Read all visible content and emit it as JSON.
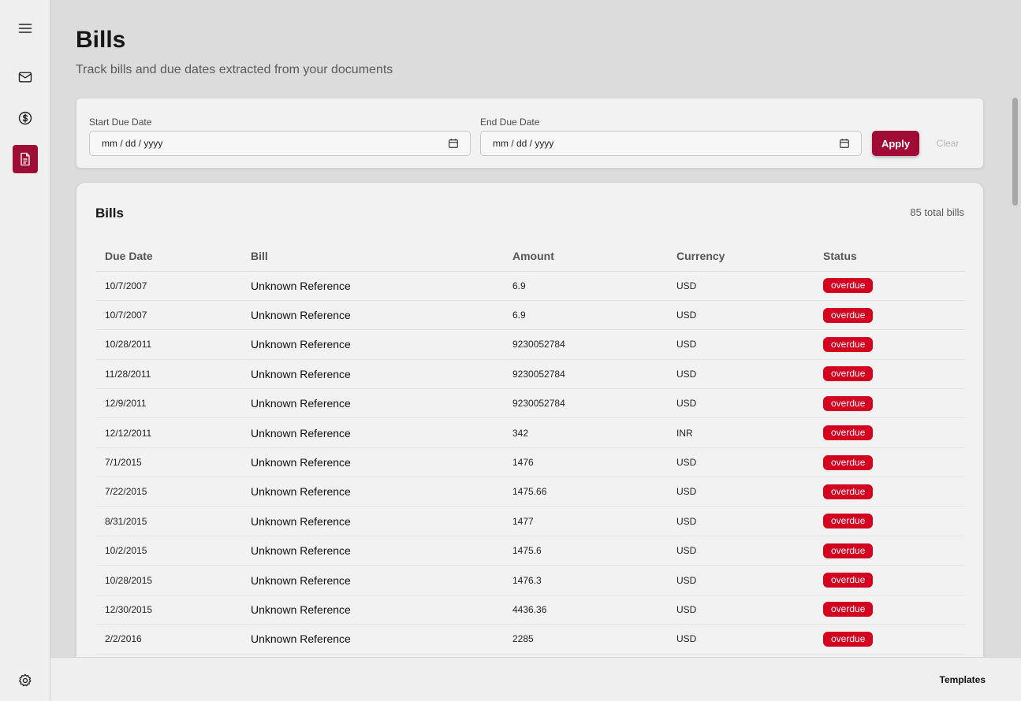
{
  "sidebar": {
    "items": [
      {
        "icon": "menu-icon",
        "active": false
      },
      {
        "icon": "mail-icon",
        "active": false
      },
      {
        "icon": "dollar-icon",
        "active": false
      },
      {
        "icon": "document-icon",
        "active": true
      },
      {
        "icon": "gear-icon",
        "active": false
      }
    ],
    "accent_color": "#9e0b33"
  },
  "header": {
    "title": "Bills",
    "subtitle": "Track bills and due dates extracted from your documents"
  },
  "filters": {
    "start_label": "Start Due Date",
    "start_placeholder": "mm / dd / yyyy",
    "end_label": "End Due Date",
    "end_placeholder": "mm / dd / yyyy",
    "apply_label": "Apply",
    "clear_label": "Clear"
  },
  "bills": {
    "title": "Bills",
    "total": "85 total bills",
    "columns": [
      "Due Date",
      "Bill",
      "Amount",
      "Currency",
      "Status"
    ],
    "rows": [
      [
        "10/7/2007",
        "Unknown Reference",
        "6.9",
        "USD",
        "overdue"
      ],
      [
        "10/7/2007",
        "Unknown Reference",
        "6.9",
        "USD",
        "overdue"
      ],
      [
        "10/28/2011",
        "Unknown Reference",
        "9230052784",
        "USD",
        "overdue"
      ],
      [
        "11/28/2011",
        "Unknown Reference",
        "9230052784",
        "USD",
        "overdue"
      ],
      [
        "12/9/2011",
        "Unknown Reference",
        "9230052784",
        "USD",
        "overdue"
      ],
      [
        "12/12/2011",
        "Unknown Reference",
        "342",
        "INR",
        "overdue"
      ],
      [
        "7/1/2015",
        "Unknown Reference",
        "1476",
        "USD",
        "overdue"
      ],
      [
        "7/22/2015",
        "Unknown Reference",
        "1475.66",
        "USD",
        "overdue"
      ],
      [
        "8/31/2015",
        "Unknown Reference",
        "1477",
        "USD",
        "overdue"
      ],
      [
        "10/2/2015",
        "Unknown Reference",
        "1475.6",
        "USD",
        "overdue"
      ],
      [
        "10/28/2015",
        "Unknown Reference",
        "1476.3",
        "USD",
        "overdue"
      ],
      [
        "12/30/2015",
        "Unknown Reference",
        "4436.36",
        "USD",
        "overdue"
      ],
      [
        "2/2/2016",
        "Unknown Reference",
        "2285",
        "USD",
        "overdue"
      ]
    ],
    "status_color": "#d4001f"
  },
  "footer": {
    "templates_label": "Templates"
  }
}
